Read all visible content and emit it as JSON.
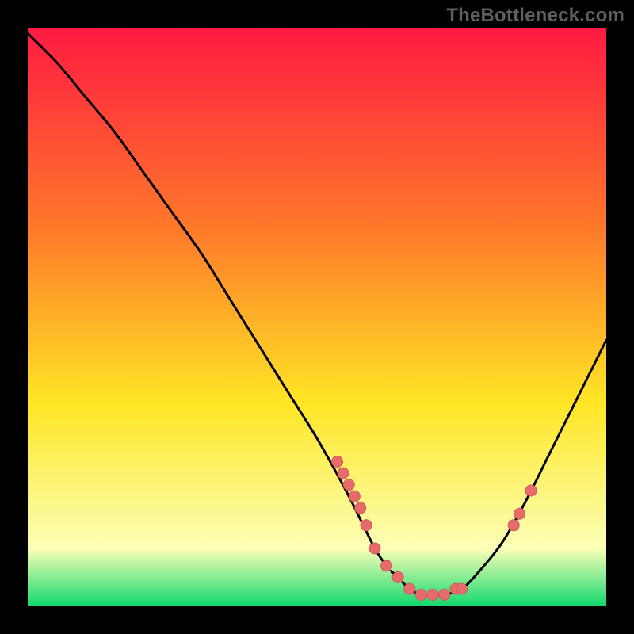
{
  "watermark": "TheBottleneck.com",
  "colors": {
    "background": "#000000",
    "gradient_top": "#ff1a42",
    "gradient_mid1": "#ff7a2a",
    "gradient_mid2": "#ffe625",
    "gradient_low": "#fbffb7",
    "gradient_bottom": "#12d96e",
    "curve": "#000000",
    "marker_fill": "#e86b6b",
    "marker_stroke": "#cd5a5a"
  },
  "chart_data": {
    "type": "line",
    "title": "",
    "xlabel": "",
    "ylabel": "",
    "xlim": [
      0,
      100
    ],
    "ylim": [
      0,
      100
    ],
    "series": [
      {
        "name": "bottleneck-curve",
        "x": [
          0,
          5,
          10,
          15,
          20,
          25,
          30,
          35,
          40,
          45,
          50,
          55,
          58,
          60,
          62,
          64,
          66,
          68,
          70,
          72,
          75,
          78,
          82,
          86,
          90,
          94,
          98,
          100
        ],
        "y": [
          99,
          94,
          88,
          82,
          75,
          68,
          61,
          53,
          45,
          37,
          29,
          20,
          14,
          10,
          7,
          5,
          3,
          2,
          2,
          2,
          3,
          6,
          11,
          18,
          26,
          34,
          42,
          46
        ]
      }
    ],
    "markers": {
      "name": "highlight-points",
      "x": [
        53.5,
        54.5,
        55.5,
        56.5,
        57.5,
        58.5,
        60,
        62,
        64,
        66,
        68,
        70,
        72,
        74,
        75,
        84,
        85,
        87
      ],
      "y": [
        25,
        23,
        21,
        19,
        17,
        14,
        10,
        7,
        5,
        3,
        2,
        2,
        2,
        3,
        3,
        14,
        16,
        20
      ]
    }
  }
}
